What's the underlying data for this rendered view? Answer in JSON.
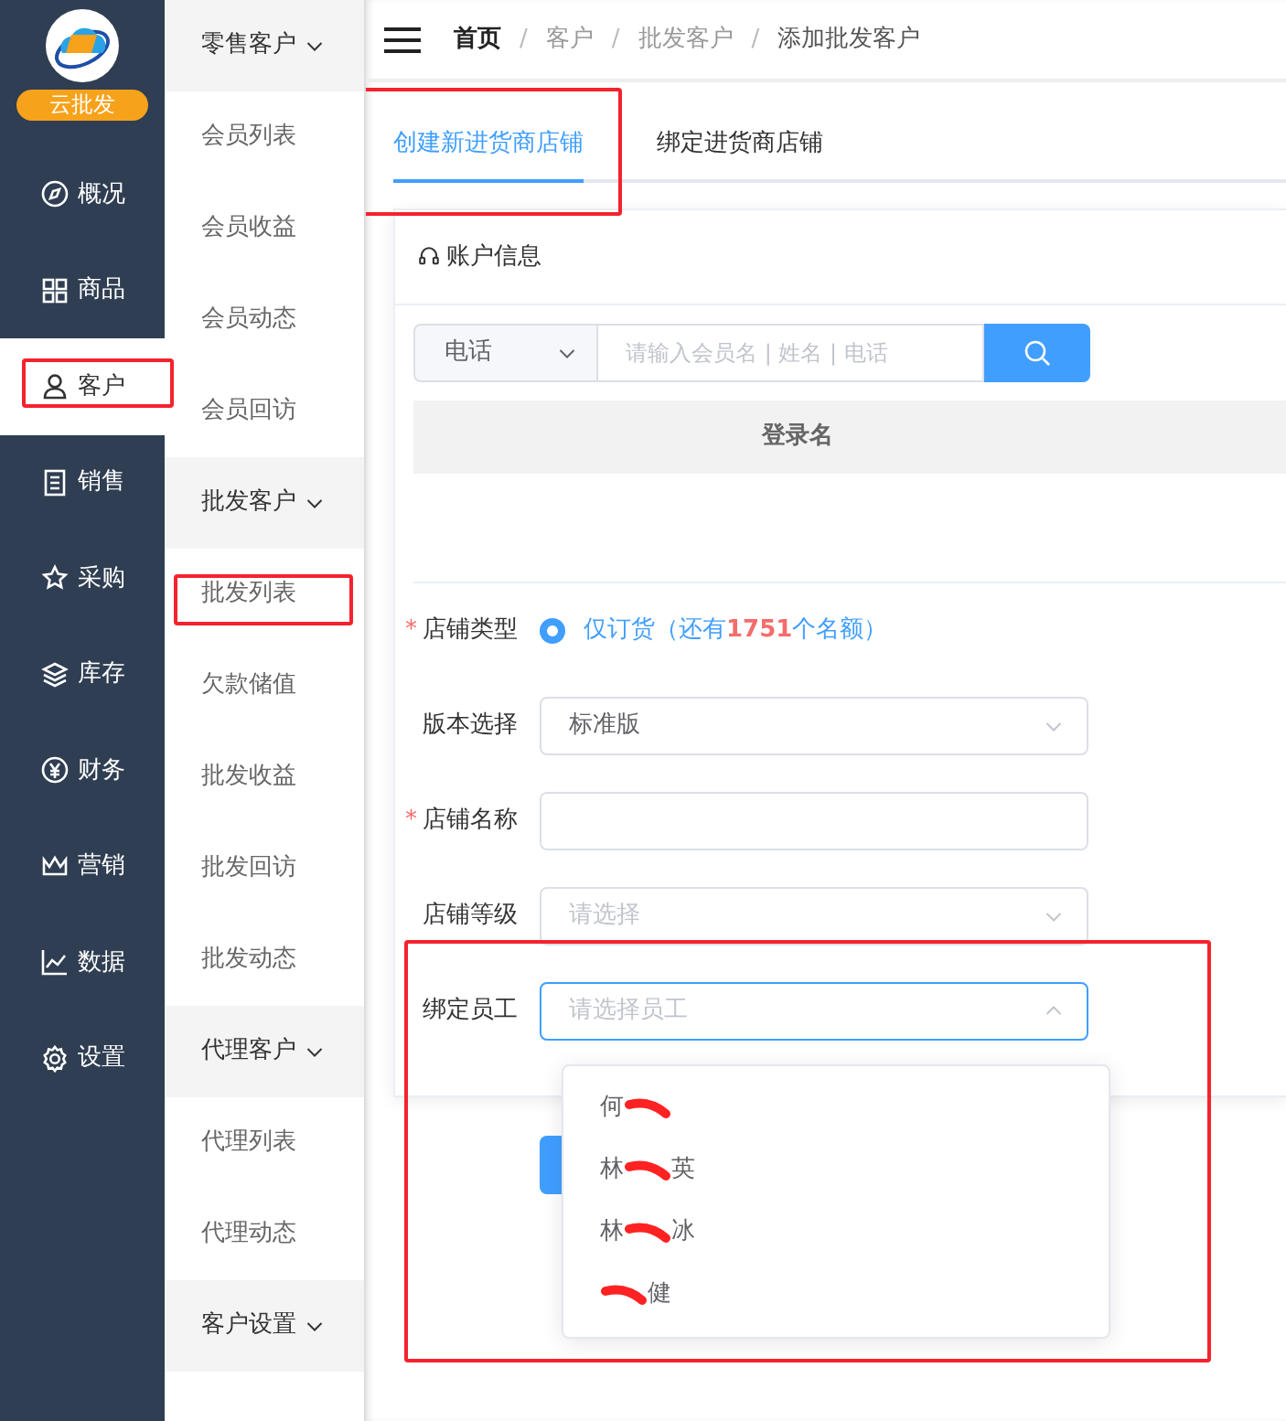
{
  "logo": {
    "badge": "云批发"
  },
  "sidebar": {
    "items": [
      {
        "label": "概况",
        "selected": false,
        "highlighted": false
      },
      {
        "label": "商品",
        "selected": false,
        "highlighted": false
      },
      {
        "label": "客户",
        "selected": true,
        "highlighted": true
      },
      {
        "label": "销售",
        "selected": false,
        "highlighted": false
      },
      {
        "label": "采购",
        "selected": false,
        "highlighted": false
      },
      {
        "label": "库存",
        "selected": false,
        "highlighted": false
      },
      {
        "label": "财务",
        "selected": false,
        "highlighted": false
      },
      {
        "label": "营销",
        "selected": false,
        "highlighted": false
      },
      {
        "label": "数据",
        "selected": false,
        "highlighted": false
      },
      {
        "label": "设置",
        "selected": false,
        "highlighted": false
      }
    ]
  },
  "submenu": {
    "groups": [
      {
        "title": "零售客户",
        "expanded": true,
        "items": [
          {
            "label": "会员列表",
            "highlighted": false
          },
          {
            "label": "会员收益",
            "highlighted": false
          },
          {
            "label": "会员动态",
            "highlighted": false
          },
          {
            "label": "会员回访",
            "highlighted": false
          }
        ]
      },
      {
        "title": "批发客户",
        "expanded": true,
        "items": [
          {
            "label": "批发列表",
            "highlighted": true
          },
          {
            "label": "欠款储值",
            "highlighted": false
          },
          {
            "label": "批发收益",
            "highlighted": false
          },
          {
            "label": "批发回访",
            "highlighted": false
          },
          {
            "label": "批发动态",
            "highlighted": false
          }
        ]
      },
      {
        "title": "代理客户",
        "expanded": true,
        "items": [
          {
            "label": "代理列表",
            "highlighted": false
          },
          {
            "label": "代理动态",
            "highlighted": false
          }
        ]
      },
      {
        "title": "客户设置",
        "expanded": true
      }
    ]
  },
  "breadcrumb": [
    {
      "label": "首页",
      "kind": "home"
    },
    {
      "separator": "/",
      "label": "客户",
      "kind": "link"
    },
    {
      "separator": "/",
      "label": "批发客户",
      "kind": "link"
    },
    {
      "separator": "/",
      "label": "添加批发客户",
      "kind": "current"
    }
  ],
  "tabs": [
    {
      "label": "创建新进货商店铺",
      "selected": true,
      "highlighted": true
    },
    {
      "label": "绑定进货商店铺",
      "selected": false,
      "highlighted": false
    }
  ],
  "account_card": {
    "title": "账户信息",
    "search": {
      "type_value": "电话",
      "placeholder": "请输入会员名 | 姓名 | 电话"
    },
    "table": {
      "columns": [
        "登录名"
      ]
    }
  },
  "form": {
    "rows": [
      {
        "required_mark": "*",
        "label": "店铺类型",
        "kind": "radio",
        "option": {
          "before": "仅订货（还有",
          "count": "1751",
          "after": "个名额）",
          "checked": true
        }
      },
      {
        "label": "版本选择",
        "kind": "select",
        "value": "标准版",
        "open": false
      },
      {
        "required_mark": "*",
        "label": "店铺名称",
        "kind": "input"
      },
      {
        "label": "店铺等级",
        "kind": "select",
        "placeholder": "请选择",
        "open": false
      },
      {
        "label": "绑定员工",
        "kind": "select",
        "placeholder": "请选择员工",
        "open": true,
        "highlighted": true,
        "options": [
          {
            "before": "何",
            "redacted": true
          },
          {
            "before": "林",
            "redacted": true,
            "after": "英"
          },
          {
            "before": "林",
            "redacted": true,
            "after": "冰"
          },
          {
            "redacted": true,
            "after": "健"
          }
        ]
      }
    ]
  }
}
